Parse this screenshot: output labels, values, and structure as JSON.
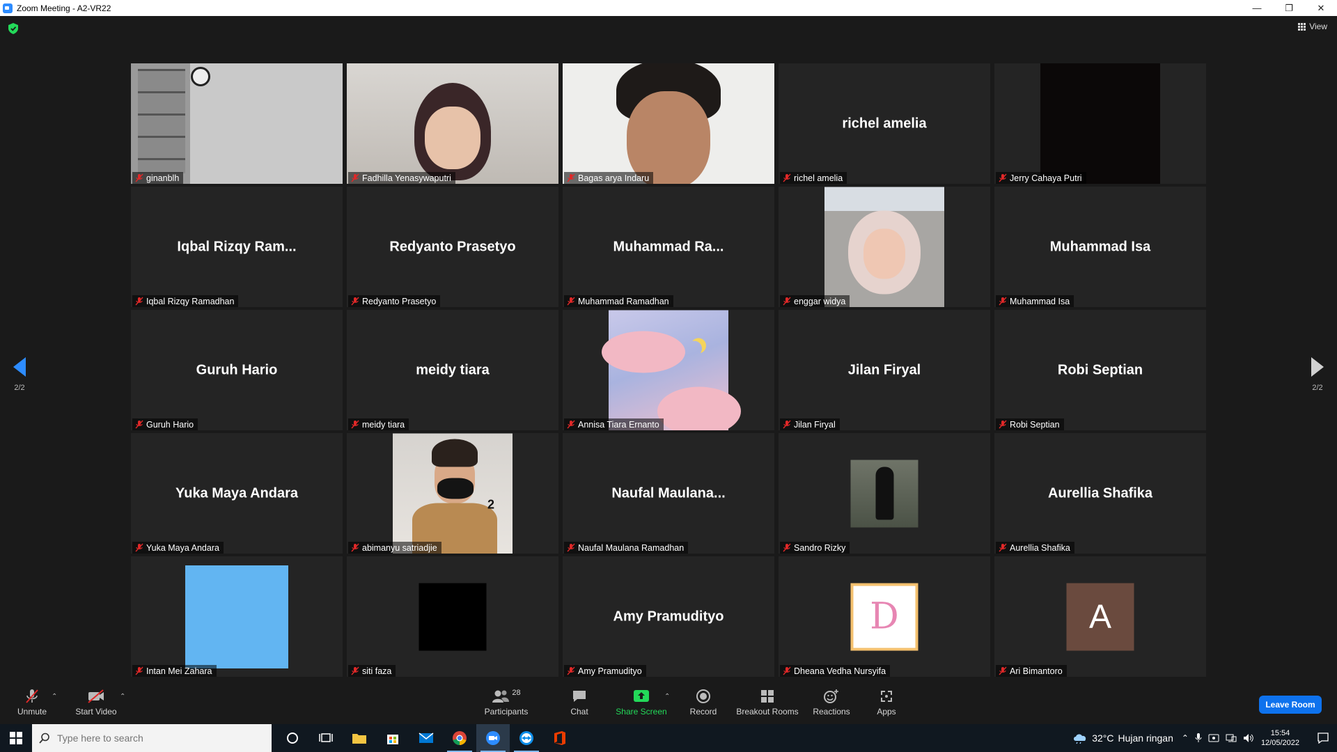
{
  "window": {
    "title": "Zoom Meeting - A2-VR22",
    "controls": [
      "—",
      "❐",
      "✕"
    ]
  },
  "header": {
    "view_label": "View"
  },
  "pagination": {
    "left": "2/2",
    "right": "2/2"
  },
  "tiles": [
    {
      "label": "ginanblh",
      "big": ""
    },
    {
      "label": "Fadhilla Yenasywaputri",
      "big": ""
    },
    {
      "label": "Bagas arya Indaru",
      "big": ""
    },
    {
      "label": "richel amelia",
      "big": "richel amelia"
    },
    {
      "label": "Jerry Cahaya Putri",
      "big": ""
    },
    {
      "label": "Iqbal Rizqy Ramadhan",
      "big": "Iqbal Rizqy Ram..."
    },
    {
      "label": "Redyanto Prasetyo",
      "big": "Redyanto Prasetyo"
    },
    {
      "label": "Muhammad Ramadhan",
      "big": "Muhammad  Ra..."
    },
    {
      "label": "enggar widya",
      "big": ""
    },
    {
      "label": "Muhammad Isa",
      "big": "Muhammad Isa"
    },
    {
      "label": "Guruh Hario",
      "big": "Guruh Hario"
    },
    {
      "label": "meidy tiara",
      "big": "meidy tiara"
    },
    {
      "label": "Annisa Tiara Ernanto",
      "big": ""
    },
    {
      "label": "Jilan Firyal",
      "big": "Jilan Firyal"
    },
    {
      "label": "Robi Septian",
      "big": "Robi Septian"
    },
    {
      "label": "Yuka Maya Andara",
      "big": "Yuka Maya Andara"
    },
    {
      "label": "abimanyu satriadjie",
      "big": ""
    },
    {
      "label": "Naufal Maulana Ramadhan",
      "big": "Naufal  Maulana..."
    },
    {
      "label": "Sandro Rizky",
      "big": ""
    },
    {
      "label": "Aurellia Shafika",
      "big": "Aurellia Shafika"
    },
    {
      "label": "Intan Mei Zahara",
      "big": ""
    },
    {
      "label": "siti faza",
      "big": ""
    },
    {
      "label": "Amy Pramudityo",
      "big": "Amy Pramudityo"
    },
    {
      "label": "Dheana Vedha Nursyifa",
      "big": ""
    },
    {
      "label": "Ari Bimantoro",
      "big": ""
    }
  ],
  "avatars": {
    "abimanyu_number": "2",
    "dheana_letter": "D",
    "ari_letter": "A"
  },
  "toolbar": {
    "unmute": "Unmute",
    "start_video": "Start Video",
    "participants": "Participants",
    "participants_count": "28",
    "chat": "Chat",
    "share_screen": "Share Screen",
    "record": "Record",
    "breakout_rooms": "Breakout Rooms",
    "reactions": "Reactions",
    "apps": "Apps",
    "leave_room": "Leave Room"
  },
  "taskbar": {
    "search_placeholder": "Type here to search",
    "weather_temp": "32°C",
    "weather_desc": "Hujan ringan",
    "time": "15:54",
    "date": "12/05/2022"
  },
  "colors": {
    "accent_blue": "#2d8cff",
    "share_green": "#23d959",
    "mute_red": "#e02828",
    "leave_blue": "#0e72ed"
  }
}
